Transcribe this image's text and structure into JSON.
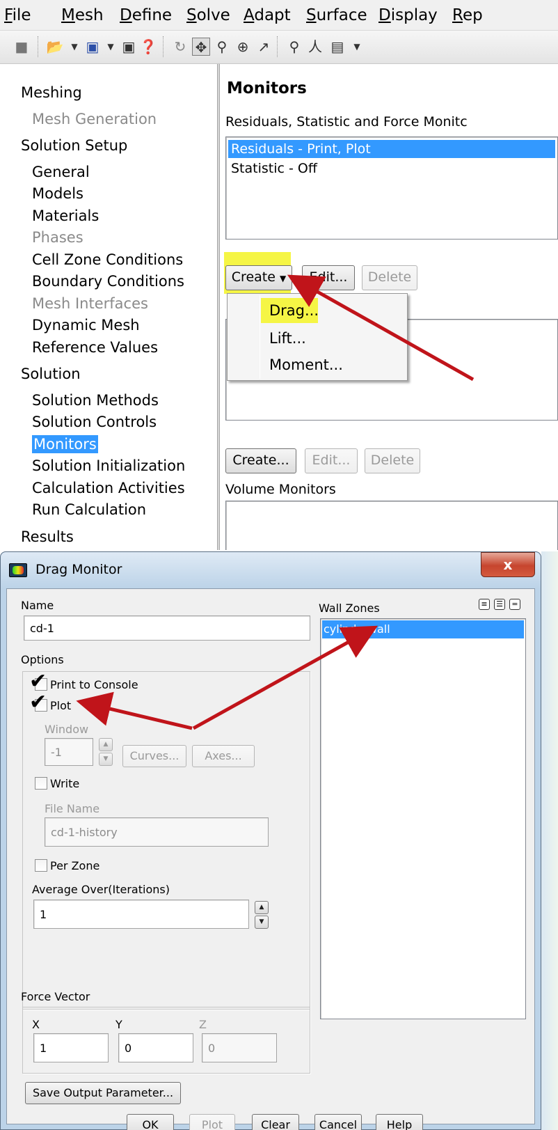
{
  "menubar": {
    "items": [
      "File",
      "Mesh",
      "Define",
      "Solve",
      "Adapt",
      "Surface",
      "Display",
      "Rep"
    ]
  },
  "toolbar": {
    "icons": [
      "mesh-icon",
      "open-folder-icon",
      "save-icon",
      "screenshot-icon",
      "help-icon",
      "rotate-icon",
      "pan-icon",
      "zoom-fit-icon",
      "zoom-in-icon",
      "probe-icon",
      "zoom-box-icon",
      "axes-icon",
      "layout-icon"
    ]
  },
  "nav": {
    "meshing": "Meshing",
    "mesh_generation": "Mesh Generation",
    "solution_setup": "Solution Setup",
    "general": "General",
    "models": "Models",
    "materials": "Materials",
    "phases": "Phases",
    "cell_zone_conditions": "Cell Zone Conditions",
    "boundary_conditions": "Boundary Conditions",
    "mesh_interfaces": "Mesh Interfaces",
    "dynamic_mesh": "Dynamic Mesh",
    "reference_values": "Reference Values",
    "solution": "Solution",
    "solution_methods": "Solution Methods",
    "solution_controls": "Solution Controls",
    "monitors": "Monitors",
    "solution_initialization": "Solution Initialization",
    "calculation_activities": "Calculation Activities",
    "run_calculation": "Run Calculation",
    "results": "Results"
  },
  "monitors_panel": {
    "title": "Monitors",
    "subtitle": "Residuals, Statistic and Force Monitc",
    "list": [
      "Residuals - Print, Plot",
      "Statistic - Off"
    ],
    "create_label": "Create",
    "edit_label": "Edit...",
    "delete_label": "Delete",
    "dropdown": [
      "Drag...",
      "Lift...",
      "Moment..."
    ],
    "create2_label": "Create...",
    "edit2_label": "Edit...",
    "delete2_label": "Delete",
    "volume_monitors": "Volume Monitors"
  },
  "dialog": {
    "title": "Drag Monitor",
    "close": "x",
    "name_label": "Name",
    "name_value": "cd-1",
    "options_label": "Options",
    "print_to_console": "Print to Console",
    "plot": "Plot",
    "window_label": "Window",
    "window_value": "-1",
    "curves_label": "Curves...",
    "axes_label": "Axes...",
    "write": "Write",
    "file_name_label": "File Name",
    "file_name_value": "cd-1-history",
    "per_zone": "Per Zone",
    "average_over_label": "Average Over(Iterations)",
    "average_over_value": "1",
    "force_vector_label": "Force Vector",
    "x_label": "X",
    "x_value": "1",
    "y_label": "Y",
    "y_value": "0",
    "z_label": "Z",
    "z_value": "0",
    "save_output_parameter": "Save Output Parameter...",
    "wall_zones_label": "Wall Zones",
    "wall_zones": [
      "cylinderwall"
    ],
    "ok": "OK",
    "plot_btn": "Plot",
    "clear": "Clear",
    "cancel": "Cancel",
    "help": "Help"
  },
  "colors": {
    "selection": "#3399ff",
    "highlight": "#f5f545",
    "arrow": "#c0141a"
  }
}
